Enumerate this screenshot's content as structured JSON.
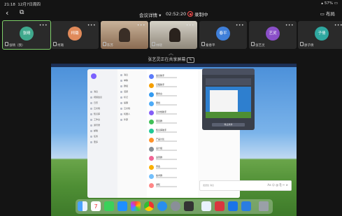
{
  "status_bar": {
    "time": "21:18",
    "date": "12月7日周四",
    "battery": "57%"
  },
  "top_bar": {
    "title": "会议详情",
    "elapsed": "02:52:20",
    "recording": "录制中",
    "layout_label": "布局"
  },
  "participants": [
    {
      "avatar_text": "张晴",
      "name": "张晴（我）",
      "color": "#3fa88c",
      "active": true
    },
    {
      "avatar_text": "柯璐",
      "name": "柯璐",
      "color": "#e08a5a",
      "active": false
    },
    {
      "avatar_text": "",
      "name": "陈苏",
      "color": "#8a6b52",
      "active": false,
      "video": true
    },
    {
      "avatar_text": "",
      "name": "林晓",
      "color": "#6b5a49",
      "active": false,
      "video": true
    },
    {
      "avatar_text": "春平",
      "name": "秦春平",
      "color": "#3f7fd9",
      "active": false
    },
    {
      "avatar_text": "艺灵",
      "name": "张艺灵",
      "color": "#8a4fc8",
      "active": false
    },
    {
      "avatar_text": "子倩",
      "name": "廖子倩",
      "color": "#2fa8a0",
      "active": false
    }
  ],
  "share": {
    "label": "张艺灵正在共享屏幕"
  },
  "shared_app": {
    "sidebar_items": [
      "消息",
      "视频会议",
      "日历",
      "云文档",
      "知识库",
      "工作台",
      "通讯录",
      "邮箱",
      "任务",
      "更多"
    ],
    "sidebar2_items": [
      "消息",
      "单聊",
      "群组",
      "话题",
      "标记",
      "提醒",
      "云文档",
      "机器人",
      "外部"
    ],
    "chat_list": [
      {
        "title": "会议助手",
        "color": "#5c7cfa"
      },
      {
        "title": "日程助手",
        "color": "#f59f00"
      },
      {
        "title": "服务台",
        "color": "#339af0"
      },
      {
        "title": "审批",
        "color": "#4dabf7"
      },
      {
        "title": "云文档助手",
        "color": "#845ef7"
      },
      {
        "title": "项目群",
        "color": "#40c057"
      },
      {
        "title": "知识库助手",
        "color": "#20c997"
      },
      {
        "title": "产品讨论",
        "color": "#ff922b"
      },
      {
        "title": "设计组",
        "color": "#868e96"
      },
      {
        "title": "运营群",
        "color": "#f06595"
      },
      {
        "title": "周会",
        "color": "#fab005"
      },
      {
        "title": "技术群",
        "color": "#74c0fc"
      },
      {
        "title": "通知",
        "color": "#ff8787"
      }
    ],
    "popup_button": "停止共享",
    "input_placeholder": "发送给 消息"
  },
  "dock_icons": [
    "finder-icon",
    "calendar-icon",
    "messages-icon",
    "appstore-icon",
    "photos-icon",
    "chrome-icon",
    "safari-icon",
    "settings-icon",
    "app-icon",
    "app2-icon",
    "word-icon",
    "mail-icon",
    "vpn-icon",
    "trash-icon"
  ]
}
